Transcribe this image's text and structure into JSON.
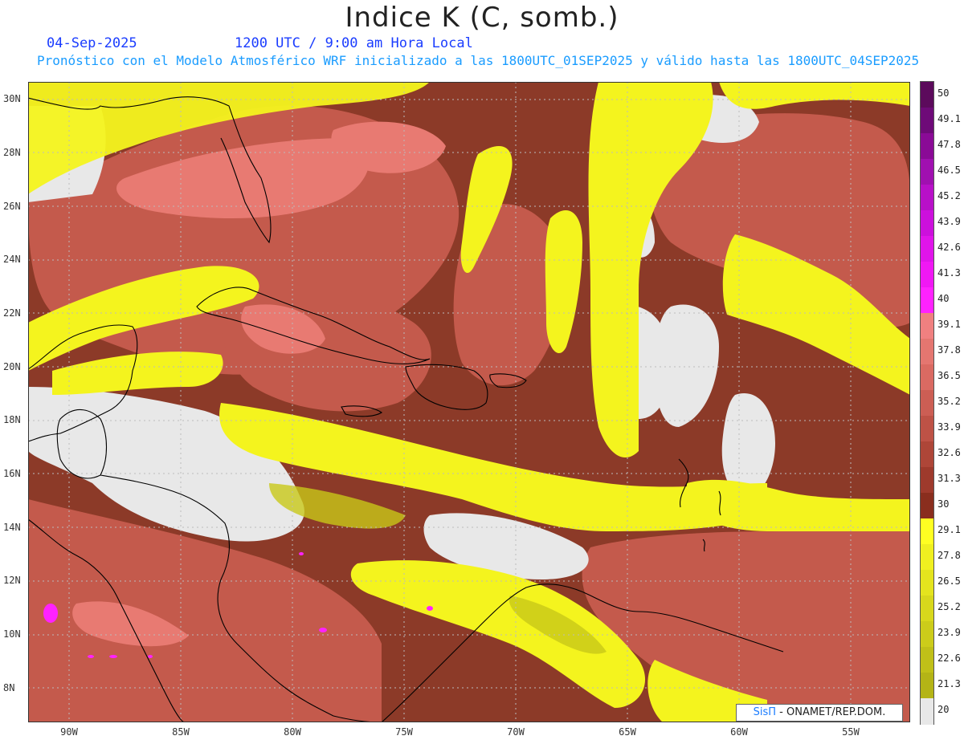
{
  "header": {
    "title": "Indice K (C, somb.)",
    "date": "04-Sep-2025",
    "time": "1200 UTC / 9:00 am Hora Local",
    "description": "Pronóstico con el Modelo Atmosférico WRF inicializado a las 1800UTC_01SEP2025 y válido hasta las  1800UTC_04SEP2025"
  },
  "map": {
    "lat_labels": [
      "30N",
      "28N",
      "26N",
      "24N",
      "22N",
      "20N",
      "18N",
      "16N",
      "14N",
      "12N",
      "10N",
      "8N"
    ],
    "lon_labels": [
      "90W",
      "85W",
      "80W",
      "75W",
      "70W",
      "65W",
      "60W",
      "55W"
    ],
    "credit_logo": "SisΠ",
    "credit_text": " - ONAMET/REP.DOM."
  },
  "colorbar": {
    "levels": [
      "50",
      "49.1",
      "47.8",
      "46.5",
      "45.2",
      "43.9",
      "42.6",
      "41.3",
      "40",
      "39.1",
      "37.8",
      "36.5",
      "35.2",
      "33.9",
      "32.6",
      "31.3",
      "30",
      "29.1",
      "27.8",
      "26.5",
      "25.2",
      "23.9",
      "22.6",
      "21.3",
      "20"
    ],
    "colors": [
      "#5c0a5c",
      "#6e0a78",
      "#8a0a96",
      "#a010b0",
      "#b810c8",
      "#cc10dc",
      "#e014ea",
      "#f018f4",
      "#ff22ff",
      "#f08080",
      "#e47670",
      "#da6a62",
      "#cc5e54",
      "#be5246",
      "#ae4638",
      "#9e3a2c",
      "#8a2e1e",
      "#ffff22",
      "#f0f020",
      "#e4e41e",
      "#d8d81c",
      "#cccc1a",
      "#c0c018",
      "#b4b416",
      "#e8e8e8"
    ]
  },
  "colors": {
    "no_data": "#e8e8e8",
    "yellow_low": "#c8c818",
    "yellow": "#f4f41e",
    "dark_red": "#8a2e1e",
    "red": "#c45a4c",
    "pink": "#e87a72",
    "magenta": "#ff22ff",
    "coast": "#000000",
    "grid": "#bbbbbb",
    "title_blue": "#1a3cff",
    "subtitle_blue": "#1a9cff"
  }
}
